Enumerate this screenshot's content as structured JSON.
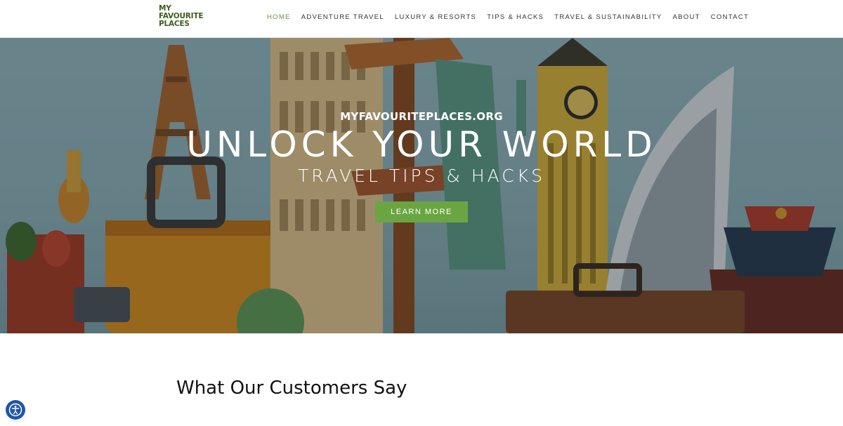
{
  "header": {
    "logo_lines": [
      "MY",
      "FAVOURITE",
      "PLACES"
    ],
    "nav": [
      {
        "label": "HOME",
        "active": true
      },
      {
        "label": "ADVENTURE TRAVEL",
        "active": false
      },
      {
        "label": "LUXURY & RESORTS",
        "active": false
      },
      {
        "label": "TIPS & HACKS",
        "active": false
      },
      {
        "label": "TRAVEL & SUSTAINABILITY",
        "active": false
      },
      {
        "label": "ABOUT",
        "active": false
      },
      {
        "label": "CONTACT",
        "active": false
      }
    ]
  },
  "hero": {
    "site_name": "MYFAVOURITEPLACES.ORG",
    "title": "UNLOCK YOUR WORLD",
    "subtitle": "TRAVEL TIPS & HACKS",
    "button_label": "LEARN MORE"
  },
  "section": {
    "title": "What Our Customers Say"
  },
  "colors": {
    "accent": "#6ba542",
    "nav_active": "#6b8e3a",
    "logo": "#3c5f1f",
    "a11y": "#1f56a8"
  },
  "icons": {
    "accessibility": "accessibility-icon"
  }
}
